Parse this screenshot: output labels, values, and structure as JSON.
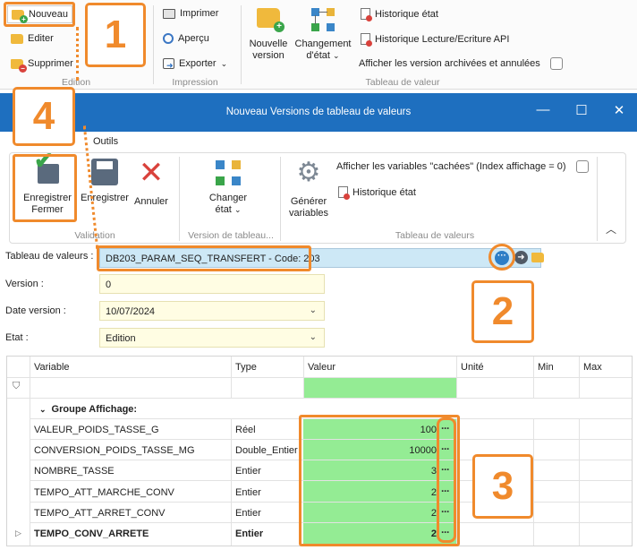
{
  "ribbon": {
    "edition": {
      "new": "Nouveau",
      "edit": "Editer",
      "delete": "Supprimer",
      "label": "Edition"
    },
    "print": {
      "print": "Imprimer",
      "preview": "Aperçu",
      "export": "Exporter",
      "label": "Impression"
    },
    "table": {
      "new_version": [
        "Nouvelle",
        "version"
      ],
      "change_state": [
        "Changement",
        "d'état"
      ],
      "history_state": "Historique état",
      "history_rw": "Historique Lecture/Ecriture API",
      "show_archived": "Afficher les version archivées et annulées",
      "label": "Tableau de valeur"
    }
  },
  "callouts": {
    "one": "1",
    "two": "2",
    "three": "3",
    "four": "4"
  },
  "dialog": {
    "title": "Nouveau Versions de tableau de valeurs",
    "tab": "Outils",
    "buttons": {
      "save_close": [
        "Enregistrer",
        "Fermer"
      ],
      "save": "Enregistrer",
      "cancel": "Annuler",
      "change_state": [
        "Changer",
        "état"
      ],
      "generate": [
        "Générer",
        "variables"
      ]
    },
    "groups": {
      "validation": "Validation",
      "version": "Version de tableau...",
      "table": "Tableau de valeurs"
    },
    "show_hidden": "Afficher les variables \"cachées\" (Index affichage = 0)",
    "history_state": "Historique état"
  },
  "form": {
    "table_label": "Tableau de valeurs :",
    "table_value": "DB203_PARAM_SEQ_TRANSFERT - Code: 203",
    "version_label": "Version :",
    "version_value": "0",
    "date_label": "Date version :",
    "date_value": "10/07/2024",
    "state_label": "Etat :",
    "state_value": "Edition"
  },
  "grid": {
    "columns": [
      "Variable",
      "Type",
      "Valeur",
      "Unité",
      "Min",
      "Max"
    ],
    "group": "Groupe Affichage:",
    "rows": [
      {
        "variable": "VALEUR_POIDS_TASSE_G",
        "type": "Réel",
        "value": "100"
      },
      {
        "variable": "CONVERSION_POIDS_TASSE_MG",
        "type": "Double_Entier",
        "value": "10000"
      },
      {
        "variable": "NOMBRE_TASSE",
        "type": "Entier",
        "value": "3"
      },
      {
        "variable": "TEMPO_ATT_MARCHE_CONV",
        "type": "Entier",
        "value": "2"
      },
      {
        "variable": "TEMPO_ATT_ARRET_CONV",
        "type": "Entier",
        "value": "2"
      },
      {
        "variable": "TEMPO_CONV_ARRETE",
        "type": "Entier",
        "value": "2"
      }
    ]
  },
  "colors": {
    "accent": "#f08a2c",
    "titlebar": "#1e6fbf",
    "value_green": "#94ec94",
    "field_yellow": "#fffde3",
    "field_blue": "#cde8f6"
  }
}
